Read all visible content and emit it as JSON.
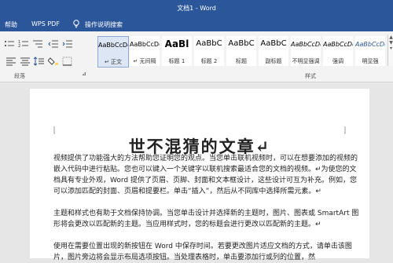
{
  "window": {
    "title": "文档1 - Word"
  },
  "menu": {
    "help": "帮助",
    "wps_pdf": "WPS PDF",
    "tell_me": "操作说明搜索"
  },
  "styles": [
    {
      "sample": "AaBbCcDd",
      "name": "↵ 正文",
      "selected": true
    },
    {
      "sample": "AaBbCcDd",
      "name": "↵ 无间隔"
    },
    {
      "sample": "AaBl",
      "name": "标题 1"
    },
    {
      "sample": "AaBbC",
      "name": "标题 2"
    },
    {
      "sample": "AaBbC",
      "name": "标题"
    },
    {
      "sample": "AaBbC",
      "name": "副标题"
    },
    {
      "sample": "AaBbCcDd",
      "name": "不明显强调"
    },
    {
      "sample": "AaBbCcDd",
      "name": "强调"
    },
    {
      "sample": "AaBbCcDd",
      "name": "明显强"
    }
  ],
  "groups": {
    "paragraph": "段落",
    "styles": "样式"
  },
  "document": {
    "title": "世不混猜的文章↵",
    "para1": "视频提供了功能强大的方法帮助您证明您的观点。当您单击联机视频时，可以在想要添加的视频的嵌入代码中进行粘贴。您也可以键入一个关键字以联机搜索最适合您的文档的视频。↵为使您的文档具有专业外观，Word 提供了页眉、页脚、封面和文本框设计，这些设计可互为补充。例如，您可以添加匹配的封面、页眉和提要栏。单击“插入”，然后从不同库中选择所需元素。↵",
    "para2": "主题和样式也有助于文档保持协调。当您单击设计并选择新的主题时，图片、图表或 SmartArt 图形将会更改以匹配新的主题。当应用样式时，您的标题会进行更改以匹配新的主题。↵",
    "para3": "使用在需要位置出现的新按钮在 Word 中保存时间。若要更改图片适应文档的方式，请单击该图片，图片旁边将会显示布局选项按钮。当处理表格时，单击要添加行或列的位置，然"
  }
}
